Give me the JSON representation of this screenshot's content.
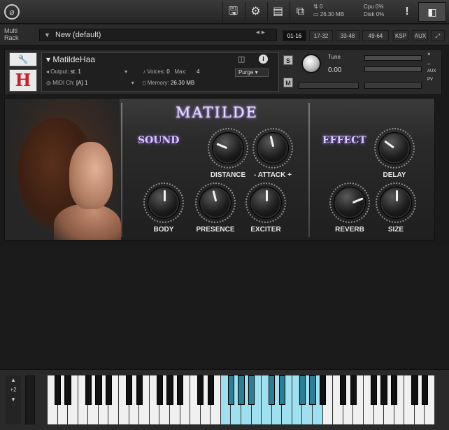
{
  "toolbar": {
    "disk_icon": "save-icon",
    "stats": {
      "midi": "0",
      "memory": "26.30 MB",
      "cpu_label": "Cpu",
      "cpu_value": "0%",
      "disk_label": "Disk",
      "disk_value": "0%"
    },
    "warning": "!"
  },
  "rack": {
    "label_line1": "Multi",
    "label_line2": "Rack",
    "name": "New (default)",
    "tabs": [
      "01-16",
      "17-32",
      "33-48",
      "49-64",
      "KSP",
      "AUX"
    ]
  },
  "instrument": {
    "name": "MatildeHaa",
    "output_label": "Output:",
    "output_value": "st. 1",
    "voices_label": "Voices:",
    "voices_value": "0",
    "max_label": "Max:",
    "max_value": "4",
    "purge_label": "Purge",
    "midi_label": "MIDI Ch:",
    "midi_value": "[A] 1",
    "memory_label": "Memory:",
    "memory_value": "26.30 MB",
    "solo": "S",
    "mute": "M",
    "tune_label": "Tune",
    "tune_value": "0.00",
    "aux": "AUX",
    "pv": "PV"
  },
  "ui": {
    "title": "MATILDE",
    "sound_label": "SOUND",
    "effect_label": "EFFECT",
    "knobs": [
      {
        "label": "DISTANCE",
        "value": 0.25
      },
      {
        "label": "- ATTACK +",
        "value": 0.45
      },
      {
        "label": "BODY",
        "value": 0.5
      },
      {
        "label": "PRESENCE",
        "value": 0.45
      },
      {
        "label": "EXCITER",
        "value": 0.5
      },
      {
        "label": "DELAY",
        "value": 0.3
      },
      {
        "label": "REVERB",
        "value": 0.75
      },
      {
        "label": "SIZE",
        "value": 0.5
      }
    ]
  },
  "keyboard": {
    "octave": "+2"
  },
  "colors": {
    "accent_glow": "#9b6bff",
    "key_highlight": "#9edff0"
  }
}
